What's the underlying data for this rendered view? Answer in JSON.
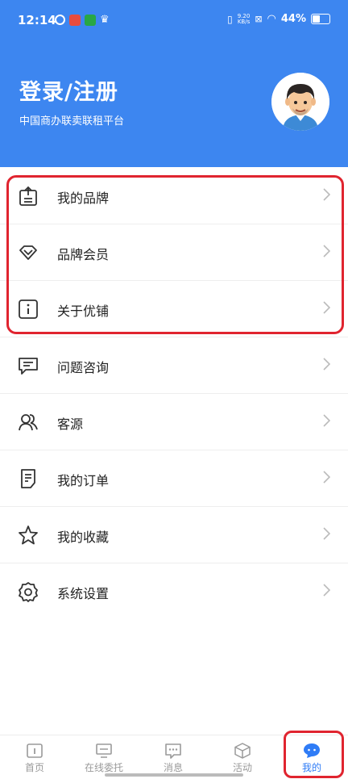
{
  "status_bar": {
    "time": "12:14",
    "net_speed_top": "9.20",
    "net_speed_bottom": "KB/s",
    "battery": "44%"
  },
  "header": {
    "title": "登录/注册",
    "subtitle": "中国商办联卖联租平台",
    "bg_color": "#3d86f0"
  },
  "menu": {
    "items": [
      {
        "label": "我的品牌",
        "icon": "brand-upload-icon"
      },
      {
        "label": "品牌会员",
        "icon": "diamond-icon"
      },
      {
        "label": "关于优铺",
        "icon": "info-icon"
      },
      {
        "label": "问题咨询",
        "icon": "chat-icon"
      },
      {
        "label": "客源",
        "icon": "users-icon"
      },
      {
        "label": "我的订单",
        "icon": "order-icon"
      },
      {
        "label": "我的收藏",
        "icon": "star-icon"
      },
      {
        "label": "系统设置",
        "icon": "gear-icon"
      }
    ]
  },
  "tabbar": {
    "tabs": [
      {
        "label": "首页",
        "icon": "home-icon"
      },
      {
        "label": "在线委托",
        "icon": "monitor-icon"
      },
      {
        "label": "消息",
        "icon": "message-icon"
      },
      {
        "label": "活动",
        "icon": "cube-icon"
      },
      {
        "label": "我的",
        "icon": "profile-chat-icon",
        "active": true
      }
    ],
    "active_color": "#2f7cf6"
  },
  "highlight_color": "#e0242f"
}
